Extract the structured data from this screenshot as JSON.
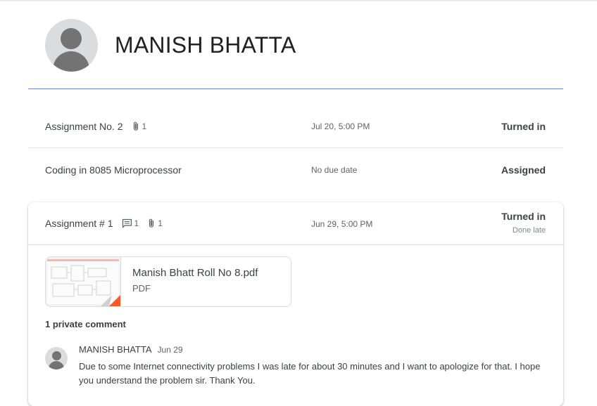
{
  "student": {
    "name": "MANISH BHATTA"
  },
  "assignments": [
    {
      "title": "Assignment No. 2",
      "attachments": "1",
      "due": "Jul 20, 5:00 PM",
      "status": "Turned in"
    },
    {
      "title": "Coding in 8085 Microprocessor",
      "due": "No due date",
      "status": "Assigned"
    }
  ],
  "expanded": {
    "title": "Assignment # 1",
    "comments_count": "1",
    "attachments": "1",
    "due": "Jun 29, 5:00 PM",
    "status": "Turned in",
    "substatus": "Done late",
    "file": {
      "name": "Manish Bhatt Roll No 8.pdf",
      "type": "PDF"
    },
    "private_comments_label": "1 private comment",
    "comment": {
      "author": "MANISH BHATTA",
      "date": "Jun 29",
      "text": "Due to some Internet connectivity problems I was late for about 30 minutes and I want to apologize for that. I hope you understand the problem sir. Thank You."
    }
  },
  "colors": {
    "accent_rule": "#3f6fd8",
    "pdf_corner": "#ff5722"
  }
}
